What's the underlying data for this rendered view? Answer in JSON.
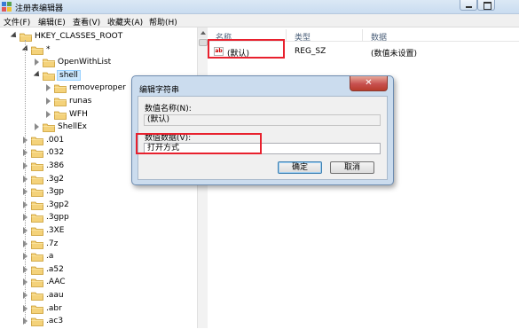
{
  "window": {
    "title": "注册表编辑器"
  },
  "menu": [
    "文件(F)",
    "编辑(E)",
    "查看(V)",
    "收藏夹(A)",
    "帮助(H)"
  ],
  "tree": [
    {
      "label": "HKEY_CLASSES_ROOT",
      "state": "expanded"
    },
    {
      "label": "*",
      "state": "expanded"
    },
    {
      "label": "OpenWithList",
      "state": "collapsed"
    },
    {
      "label": "shell",
      "state": "expanded",
      "selected": true
    },
    {
      "label": "removeproper",
      "state": "collapsed"
    },
    {
      "label": "runas",
      "state": "collapsed"
    },
    {
      "label": "WFH",
      "state": "collapsed"
    },
    {
      "label": "ShellEx",
      "state": "collapsed"
    },
    {
      "label": ".001",
      "state": "collapsed"
    },
    {
      "label": ".032",
      "state": "collapsed"
    },
    {
      "label": ".386",
      "state": "collapsed"
    },
    {
      "label": ".3g2",
      "state": "collapsed"
    },
    {
      "label": ".3gp",
      "state": "collapsed"
    },
    {
      "label": ".3gp2",
      "state": "collapsed"
    },
    {
      "label": ".3gpp",
      "state": "collapsed"
    },
    {
      "label": ".3XE",
      "state": "collapsed"
    },
    {
      "label": ".7z",
      "state": "collapsed"
    },
    {
      "label": ".a",
      "state": "collapsed"
    },
    {
      "label": ".a52",
      "state": "collapsed"
    },
    {
      "label": ".AAC",
      "state": "collapsed"
    },
    {
      "label": ".aau",
      "state": "collapsed"
    },
    {
      "label": ".abr",
      "state": "collapsed"
    },
    {
      "label": ".ac3",
      "state": "collapsed"
    }
  ],
  "list": {
    "columns": [
      "名称",
      "类型",
      "数据"
    ],
    "rows": [
      {
        "name": "(默认)",
        "type": "REG_SZ",
        "data": "(数值未设置)",
        "icon": "ab-string-icon"
      }
    ]
  },
  "dialog": {
    "title": "编辑字符串",
    "close_label": "✕",
    "name_label": "数值名称(N):",
    "name_value": "(默认)",
    "data_label": "数值数据(V):",
    "data_value": "打开方式",
    "ok_label": "确定",
    "cancel_label": "取消"
  },
  "colors": {
    "highlight_box": "#e8212e",
    "folder": "#e9c46a",
    "selection": "#cce8ff"
  }
}
